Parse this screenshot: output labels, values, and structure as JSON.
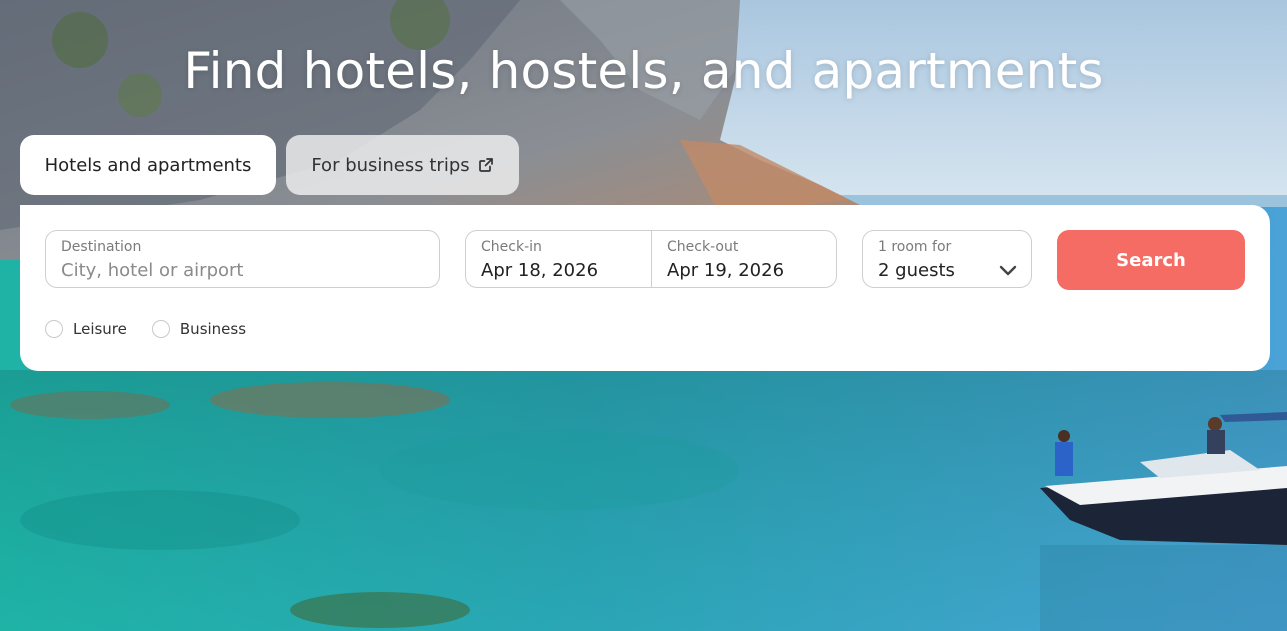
{
  "hero": {
    "title": "Find hotels, hostels, and apartments"
  },
  "tabs": [
    {
      "label": "Hotels and apartments",
      "active": true
    },
    {
      "label": "For business trips",
      "active": false,
      "icon": "external-link-icon"
    }
  ],
  "search": {
    "destination": {
      "label": "Destination",
      "placeholder": "City, hotel or airport",
      "value": ""
    },
    "checkin": {
      "label": "Check-in",
      "value": "Apr 18, 2026"
    },
    "checkout": {
      "label": "Check-out",
      "value": "Apr 19, 2026"
    },
    "guests": {
      "label": "1 room for",
      "value": "2 guests",
      "icon": "chevron-down-icon"
    },
    "button_label": "Search",
    "trip_types": [
      {
        "label": "Leisure",
        "selected": false
      },
      {
        "label": "Business",
        "selected": false
      }
    ]
  },
  "colors": {
    "accent": "#f56c64",
    "card": "#ffffff",
    "field_border": "#cfcfcf"
  }
}
